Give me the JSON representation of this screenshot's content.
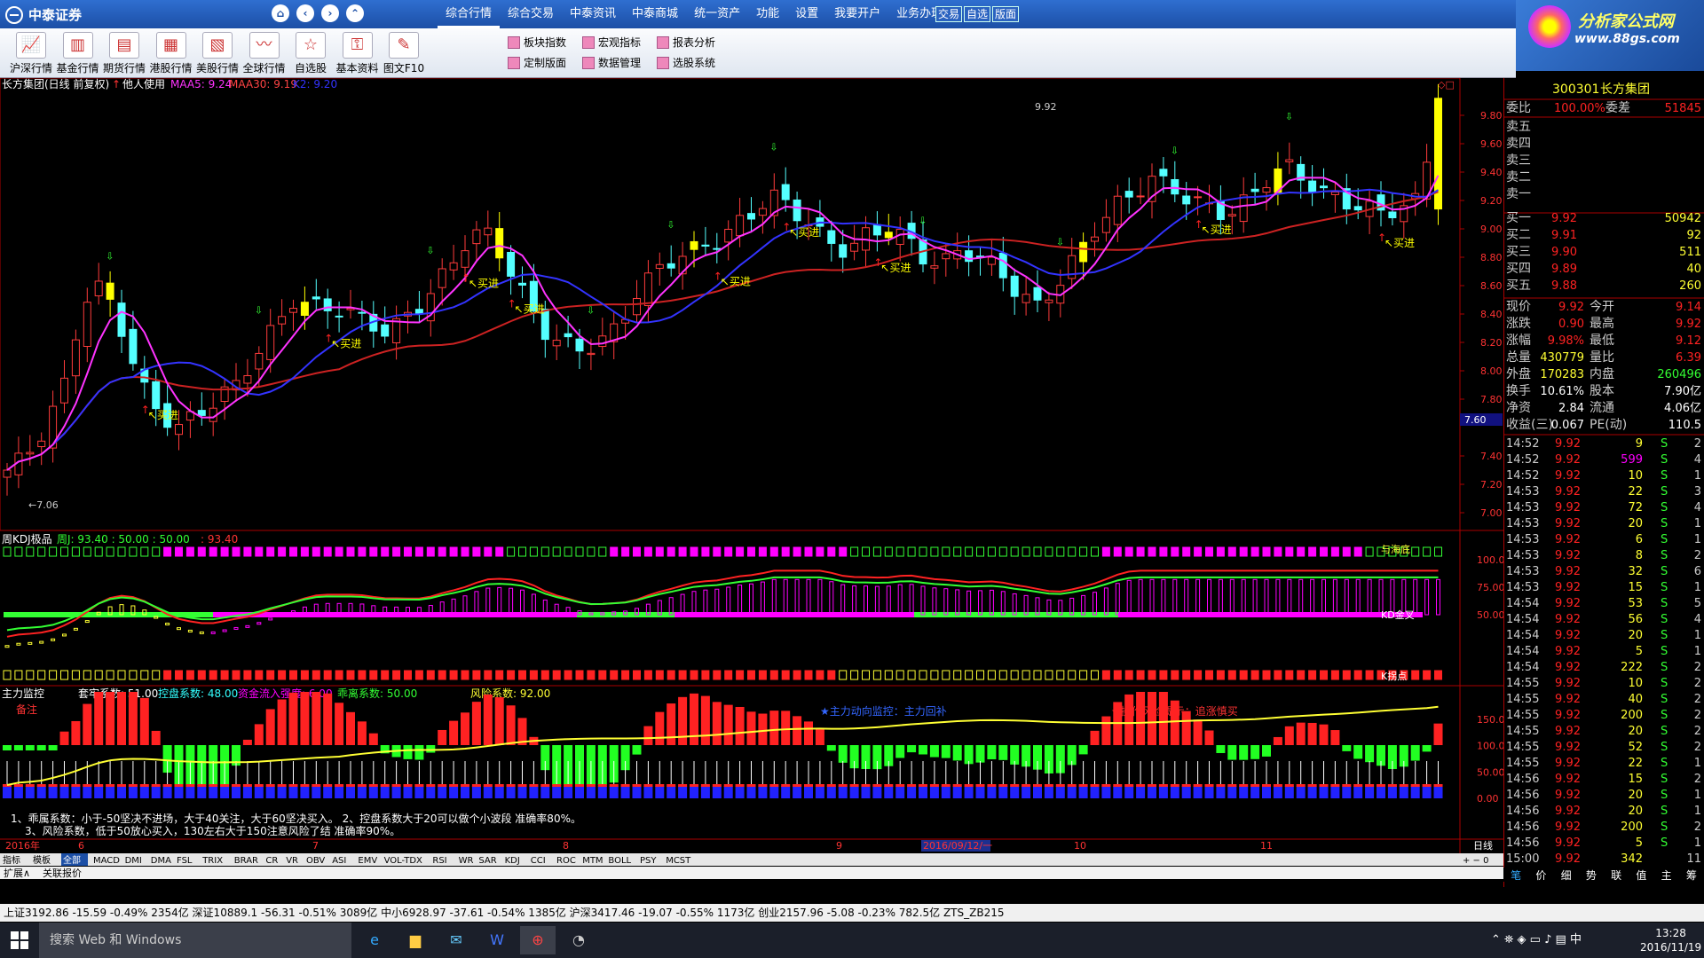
{
  "app": {
    "brand": "中泰证券",
    "nav": [
      "⌂",
      "‹",
      "›",
      "⌃"
    ]
  },
  "menu": [
    "综合行情",
    "综合交易",
    "中泰资讯",
    "中泰商城",
    "统一资产",
    "功能",
    "设置",
    "我要开户",
    "业务办理"
  ],
  "quick": [
    "交易",
    "自选",
    "版面"
  ],
  "ad": {
    "title": "分析家公式网",
    "url": "www.88gs.com"
  },
  "toolbar": {
    "big": [
      "沪深行情",
      "基金行情",
      "期货行情",
      "港股行情",
      "美股行情",
      "全球行情",
      "自选股",
      "基本资料",
      "图文F10"
    ],
    "small": [
      "板块指数",
      "宏观指标",
      "报表分析",
      "定制版面",
      "数据管理",
      "选股系统"
    ]
  },
  "main_chart": {
    "header": {
      "name": "长方集团(日线 前复权)",
      "tag": "他人使用",
      "maa5": "MAA5: 9.24",
      "maa30": "MAA30: 9.19",
      "k2": "K2: 9.20"
    },
    "yticks": [
      "9.80",
      "9.60",
      "9.40",
      "9.20",
      "9.00",
      "8.80",
      "8.60",
      "8.40",
      "8.20",
      "8.00",
      "7.80",
      "7.40",
      "7.20",
      "7.00"
    ],
    "hi_label": "9.92",
    "lo_label": "←7.06",
    "cursor_price": "7.60",
    "buy_label": "买进"
  },
  "kdj": {
    "title": "周KDJ极品",
    "j": "周J: 93.40 : 50.00 : 50.00",
    "j2": ": 93.40",
    "yticks": [
      "100.0",
      "75.00",
      "50.00"
    ],
    "tag_top": "与海底",
    "tag_mid": "KD金叉",
    "tag_bot": "K拐点"
  },
  "zljk": {
    "title": "主力监控",
    "p1": "套牢系数: 51.00",
    "p2": "控盘系数: 48.00",
    "p3": "资金流入强度: 6.00",
    "p4": "乖离系数: 50.00",
    "p5": "风险系数: 92.00",
    "note": "备注",
    "msg1": "★主力动向监控：主力回补",
    "msg2": "★操作风险提示：追涨慎买",
    "yticks": [
      "150.0",
      "100.0",
      "50.00",
      "0.00"
    ],
    "tip1": "1、乖属系数：小于-50坚决不进场，大于40关注，大于60坚决买入。       2、控盘系数大于20可以做个小波段 准确率80%。",
    "tip2": "3、风险系数，低于50放心买入，130左右大于150注意风险了结 准确率90%。"
  },
  "timeline": [
    "2016年",
    "6",
    "7",
    "8",
    "9",
    "2016/09/12/一",
    "10",
    "11",
    "日线"
  ],
  "indicator_tabs": [
    "指标",
    "模板",
    "全部",
    "MACD",
    "DMI",
    "DMA",
    "FSL",
    "TRIX",
    "BRAR",
    "CR",
    "VR",
    "OBV",
    "ASI",
    "EMV",
    "VOL-TDX",
    "RSI",
    "WR",
    "SAR",
    "KDJ",
    "CCI",
    "ROC",
    "MTM",
    "BOLL",
    "PSY",
    "MCST"
  ],
  "ext_tabs": [
    "扩展∧",
    "关联报价"
  ],
  "quote": {
    "code": "300301",
    "name": "长方集团",
    "weibi_label": "委比",
    "weibi": "100.00%",
    "weicha_label": "委差",
    "weicha": "51845",
    "sell": [
      [
        "卖五",
        ""
      ],
      [
        "卖四",
        ""
      ],
      [
        "卖三",
        ""
      ],
      [
        "卖二",
        ""
      ],
      [
        "卖一",
        ""
      ]
    ],
    "buy": [
      [
        "买一",
        "9.92",
        "50942"
      ],
      [
        "买二",
        "9.91",
        "92"
      ],
      [
        "买三",
        "9.90",
        "511"
      ],
      [
        "买四",
        "9.89",
        "40"
      ],
      [
        "买五",
        "9.88",
        "260"
      ]
    ],
    "stats": [
      [
        "现价",
        "9.92",
        "今开",
        "9.14"
      ],
      [
        "涨跌",
        "0.90",
        "最高",
        "9.92"
      ],
      [
        "涨幅",
        "9.98%",
        "最低",
        "9.12"
      ],
      [
        "总量",
        "430779",
        "量比",
        "6.39"
      ],
      [
        "外盘",
        "170283",
        "内盘",
        "260496"
      ],
      [
        "换手",
        "10.61%",
        "股本",
        "7.90亿"
      ],
      [
        "净资",
        "2.84",
        "流通",
        "4.06亿"
      ],
      [
        "收益(三)",
        "0.067",
        "PE(动)",
        "110.5"
      ]
    ],
    "ticks": [
      [
        "14:52",
        "9.92",
        "9",
        "S",
        "2"
      ],
      [
        "14:52",
        "9.92",
        "599",
        "S",
        "4"
      ],
      [
        "14:52",
        "9.92",
        "10",
        "S",
        "1"
      ],
      [
        "14:53",
        "9.92",
        "22",
        "S",
        "3"
      ],
      [
        "14:53",
        "9.92",
        "72",
        "S",
        "4"
      ],
      [
        "14:53",
        "9.92",
        "20",
        "S",
        "1"
      ],
      [
        "14:53",
        "9.92",
        "6",
        "S",
        "1"
      ],
      [
        "14:53",
        "9.92",
        "8",
        "S",
        "2"
      ],
      [
        "14:53",
        "9.92",
        "32",
        "S",
        "6"
      ],
      [
        "14:53",
        "9.92",
        "15",
        "S",
        "1"
      ],
      [
        "14:54",
        "9.92",
        "53",
        "S",
        "5"
      ],
      [
        "14:54",
        "9.92",
        "56",
        "S",
        "4"
      ],
      [
        "14:54",
        "9.92",
        "20",
        "S",
        "1"
      ],
      [
        "14:54",
        "9.92",
        "5",
        "S",
        "1"
      ],
      [
        "14:54",
        "9.92",
        "222",
        "S",
        "2"
      ],
      [
        "14:55",
        "9.92",
        "10",
        "S",
        "2"
      ],
      [
        "14:55",
        "9.92",
        "40",
        "S",
        "2"
      ],
      [
        "14:55",
        "9.92",
        "200",
        "S",
        "2"
      ],
      [
        "14:55",
        "9.92",
        "20",
        "S",
        "2"
      ],
      [
        "14:55",
        "9.92",
        "52",
        "S",
        "2"
      ],
      [
        "14:55",
        "9.92",
        "22",
        "S",
        "1"
      ],
      [
        "14:56",
        "9.92",
        "15",
        "S",
        "2"
      ],
      [
        "14:56",
        "9.92",
        "20",
        "S",
        "1"
      ],
      [
        "14:56",
        "9.92",
        "20",
        "S",
        "1"
      ],
      [
        "14:56",
        "9.92",
        "200",
        "S",
        "2"
      ],
      [
        "14:56",
        "9.92",
        "5",
        "S",
        "1"
      ],
      [
        "15:00",
        "9.92",
        "342",
        "",
        "11"
      ]
    ],
    "rtabs": [
      "笔",
      "价",
      "细",
      "势",
      "联",
      "值",
      "主",
      "筹"
    ]
  },
  "status": "上证3192.86  -15.59  -0.49%  2354亿   深证10889.1  -56.31  -0.51%  3089亿   中小6928.97  -37.61  -0.54%  1385亿   沪深3417.46  -19.07  -0.55%  1173亿   创业2157.96  -5.08  -0.23%  782.5亿           ZTS_ZB215",
  "taskbar": {
    "search": "搜索 Web 和 Windows",
    "time": "13:28",
    "date": "2016/11/19",
    "ime": "中"
  },
  "colors": {
    "up": "#ff3b3b",
    "down": "#54ffff",
    "buy": "#ffff00",
    "ma": "#ff33ff"
  }
}
